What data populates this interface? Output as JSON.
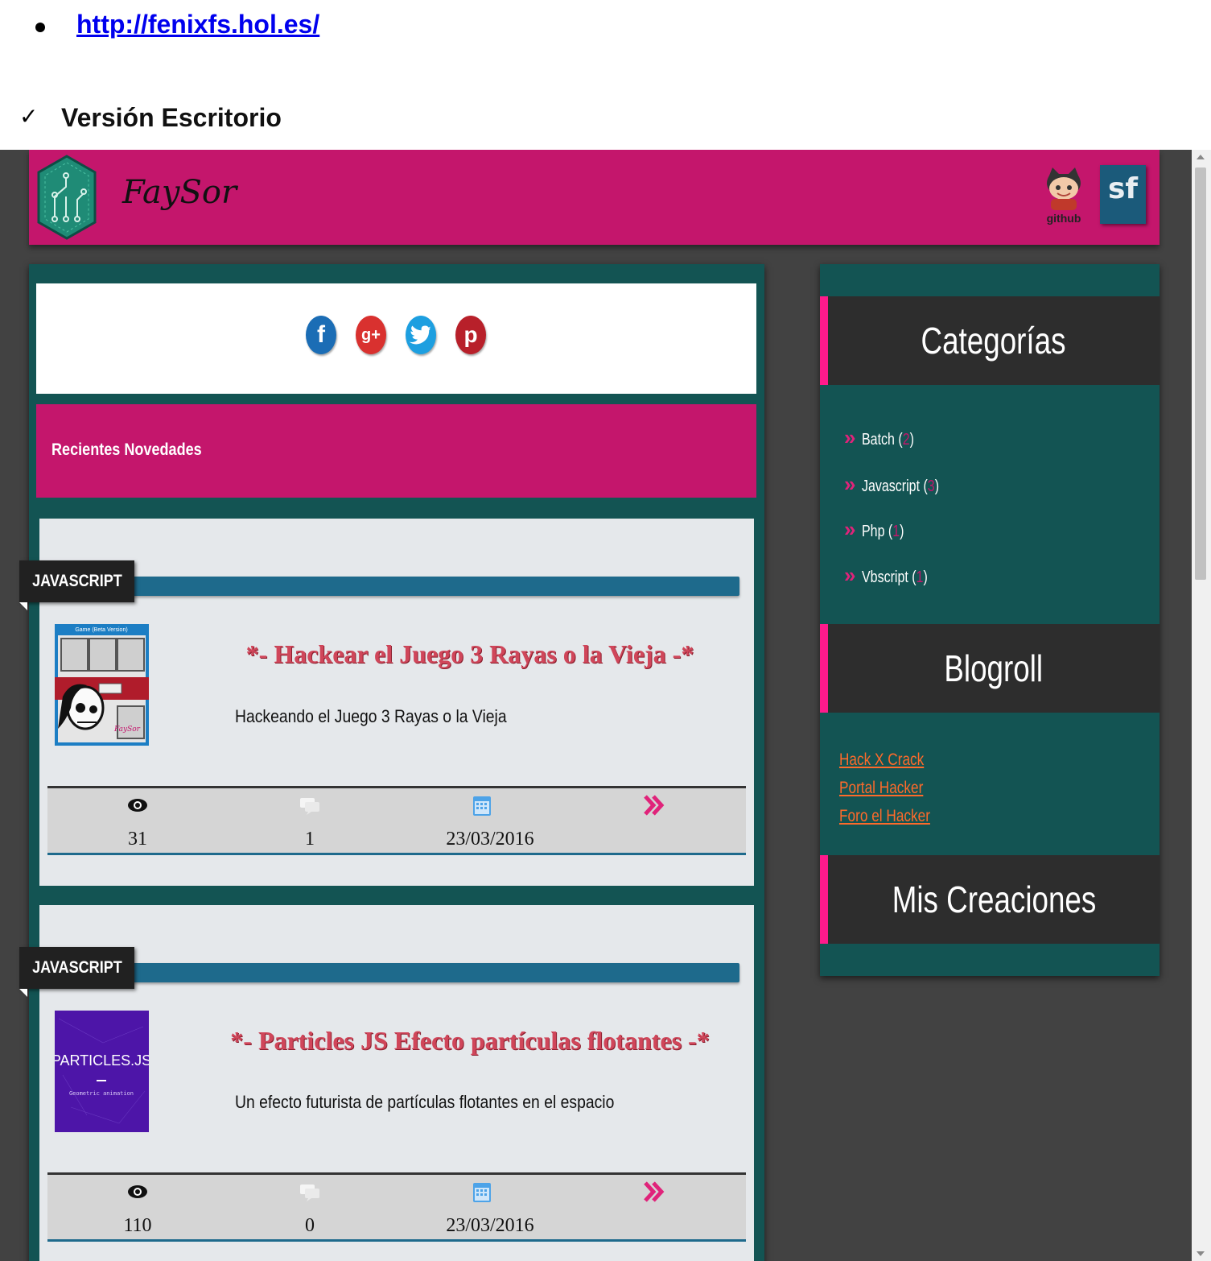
{
  "document": {
    "link": "http://fenixfs.hol.es/",
    "heading": "Versión Escritorio"
  },
  "site": {
    "brand": "FaySor",
    "github_label": "github",
    "sf_label": "sf",
    "share": [
      {
        "icon": "facebook-icon",
        "glyph": "f",
        "color": "#1b6db5"
      },
      {
        "icon": "googleplus-icon",
        "glyph": "g+",
        "color": "#d9312f"
      },
      {
        "icon": "twitter-icon",
        "glyph": "t",
        "color": "#1d9fe0"
      },
      {
        "icon": "pinterest-icon",
        "glyph": "p",
        "color": "#b8202a"
      }
    ],
    "recent_title": "Recientes Novedades",
    "posts": [
      {
        "category": "JAVASCRIPT",
        "title": "*- Hackear el Juego 3 Rayas o la Vieja -*",
        "description": "Hackeando el Juego 3 Rayas o la Vieja",
        "thumb_caption": "Game (Beta Version)",
        "thumb_brand": "FaySor",
        "views": "31",
        "comments": "1",
        "date": "23/03/2016"
      },
      {
        "category": "JAVASCRIPT",
        "title": "*- Particles JS Efecto partículas flotantes -*",
        "description": "Un efecto futurista de partículas flotantes en el espacio",
        "thumb_caption": "PARTICLES.JS",
        "thumb_sub": "Geometric animation",
        "views": "110",
        "comments": "0",
        "date": "23/03/2016"
      }
    ],
    "sidebar": {
      "categories_title": "Categorías",
      "categories": [
        {
          "name": "Batch",
          "count": "2"
        },
        {
          "name": "Javascript",
          "count": "3"
        },
        {
          "name": "Php",
          "count": "1"
        },
        {
          "name": "Vbscript",
          "count": "1"
        }
      ],
      "blogroll_title": "Blogroll",
      "blogroll": [
        "Hack X Crack",
        "Portal Hacker",
        "Foro el Hacker"
      ],
      "creations_title": "Mis Creaciones"
    }
  },
  "colors": {
    "brand_magenta": "#c4166c",
    "teal": "#135453",
    "accent_pink": "#ff1a8c",
    "link_orange": "#ff6a2a",
    "category_blue": "#1e6a8c"
  }
}
